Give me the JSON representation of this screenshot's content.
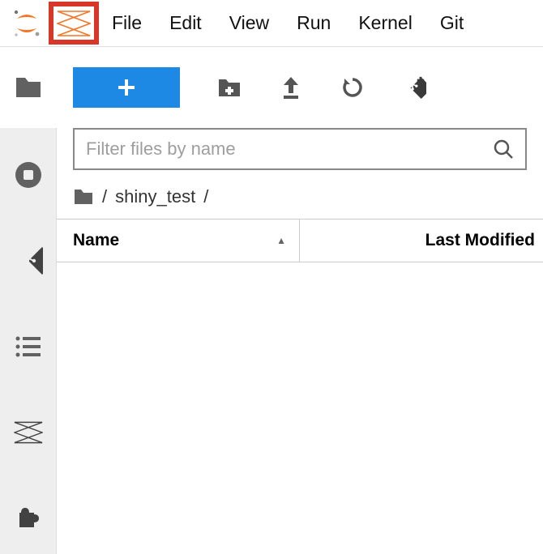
{
  "menu": {
    "file": "File",
    "edit": "Edit",
    "view": "View",
    "run": "Run",
    "kernel": "Kernel",
    "git": "Git"
  },
  "toolbar": {
    "new_label": "+"
  },
  "filter": {
    "placeholder": "Filter files by name",
    "value": ""
  },
  "breadcrumb": {
    "sep1": "/",
    "dir": "shiny_test",
    "sep2": "/"
  },
  "columns": {
    "name": "Name",
    "modified": "Last Modified"
  }
}
